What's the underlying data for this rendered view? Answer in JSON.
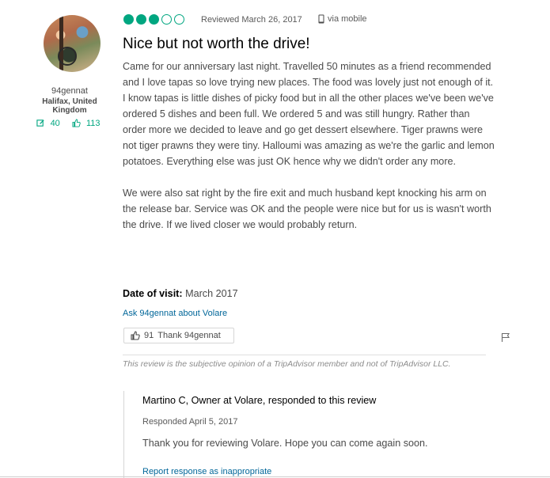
{
  "reviewer": {
    "username": "94gennat",
    "location": "Halifax, United Kingdom",
    "contributions": "40",
    "helpful_votes": "113"
  },
  "rating": {
    "value": 3,
    "max": 5
  },
  "review": {
    "reviewed_text": "Reviewed March 26, 2017",
    "via_text": "via mobile",
    "title": "Nice but not worth the drive!",
    "paragraph1": "Came for our anniversary last night. Travelled 50 minutes as a friend recommended and I love tapas so love trying new places. The food was lovely just not enough of it. I know tapas is little dishes of picky food but in all the other places we've been we've ordered 5 dishes and been full. We ordered 5 and was still hungry. Rather than order more we decided to leave and go get dessert elsewhere. Tiger prawns were not tiger prawns they were tiny. Halloumi was amazing as we're the garlic and lemon potatoes. Everything else was just OK hence why we didn't order any more.",
    "paragraph2": "We were also sat right by the fire exit and much husband kept knocking his arm on the release bar. Service was OK and the people were nice but for us is wasn't worth the drive. If we lived closer we would probably return.",
    "date_of_visit_label": "Date of visit:",
    "date_of_visit_value": "March 2017",
    "ask_link": "Ask 94gennat about Volare",
    "thank_count": "91",
    "thank_label": "Thank 94gennat",
    "disclaimer": "This review is the subjective opinion of a TripAdvisor member and not of TripAdvisor LLC."
  },
  "response": {
    "header": "Martino C, Owner at Volare, responded to this review",
    "date": "Responded April 5, 2017",
    "text": "Thank you for reviewing Volare. Hope you can come again soon.",
    "report_link": "Report response as inappropriate"
  },
  "colors": {
    "accent": "#00a680",
    "link": "#006699"
  },
  "icons": [
    "review-count-icon",
    "helpful-vote-icon",
    "mobile-phone-icon",
    "thumbs-up-icon",
    "flag-icon"
  ]
}
